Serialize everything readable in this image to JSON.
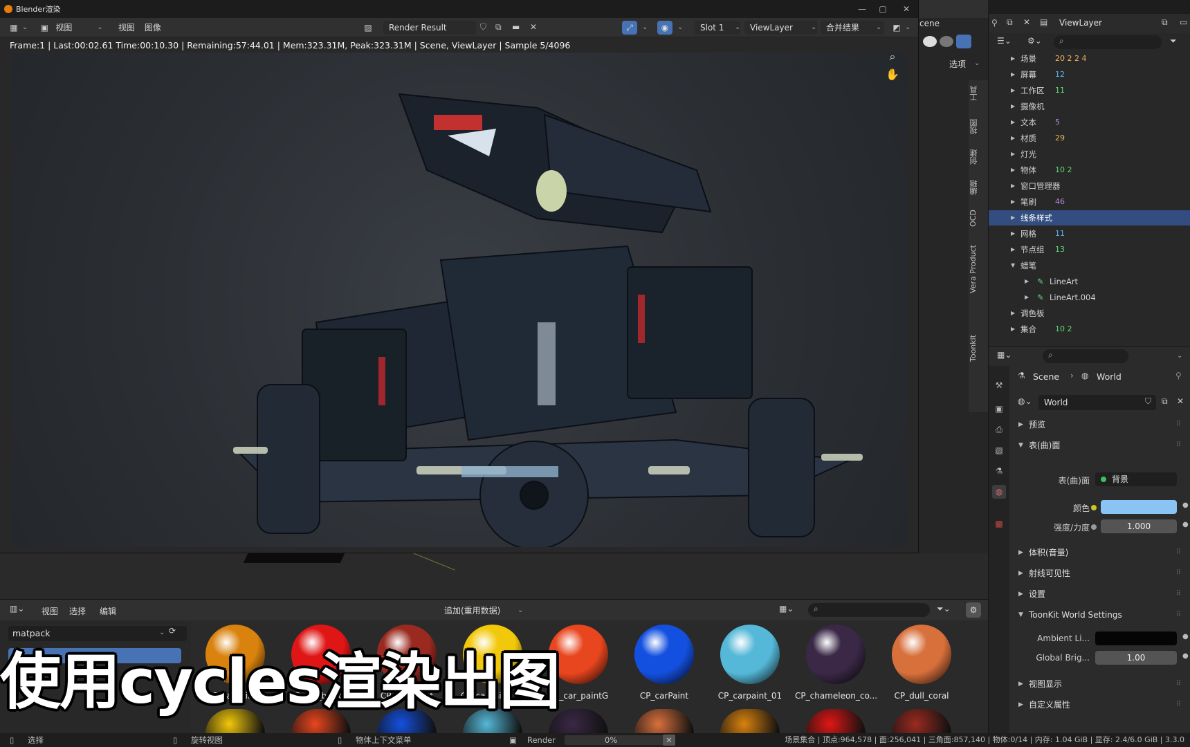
{
  "window": {
    "title": "Blender渲染",
    "controls": [
      "—",
      "▢",
      "✕"
    ]
  },
  "image_header": {
    "menus": [
      "视图",
      "视图",
      "图像"
    ],
    "image_name": "Render Result",
    "slot": "Slot 1",
    "view_layer": "ViewLayer",
    "pass": "合并结果"
  },
  "render_stats": "Frame:1 | Last:00:02.61 Time:00:10.30 | Remaining:57:44.01 | Mem:323.31M, Peak:323.31M | Scene, ViewLayer | Sample 5/4096",
  "sidebar_tabs": [
    "工具",
    "视图",
    "创建",
    "编辑",
    "OCD",
    "Vera Product",
    "Toonkit"
  ],
  "sidebar_options_label": "选项",
  "outliner": {
    "scene_fragment": "cene",
    "view_layer": "ViewLayer",
    "rows": [
      {
        "label": "场景",
        "icons": "20  2  2  4",
        "selected": false
      },
      {
        "label": "屏幕",
        "icons": "12",
        "selected": false
      },
      {
        "label": "工作区",
        "icons": "11",
        "selected": false
      },
      {
        "label": "摄像机",
        "icons": "",
        "selected": false
      },
      {
        "label": "文本",
        "icons": "5",
        "selected": false
      },
      {
        "label": "材质",
        "icons": "29",
        "selected": false
      },
      {
        "label": "灯光",
        "icons": "",
        "selected": false
      },
      {
        "label": "物体",
        "icons": "10  2",
        "selected": false
      },
      {
        "label": "窗口管理器",
        "icons": "",
        "selected": false
      },
      {
        "label": "笔刷",
        "icons": "46",
        "selected": false
      },
      {
        "label": "线条样式",
        "icons": "",
        "selected": true
      },
      {
        "label": "网格",
        "icons": "11",
        "selected": false
      },
      {
        "label": "节点组",
        "icons": "13",
        "selected": false
      },
      {
        "label": "蜡笔",
        "icons": "",
        "selected": false,
        "expanded": true
      },
      {
        "label": "LineArt",
        "icons": "",
        "child": true
      },
      {
        "label": "LineArt.004",
        "icons": "",
        "child": true
      },
      {
        "label": "调色板",
        "icons": "",
        "selected": false
      },
      {
        "label": "集合",
        "icons": "10  2",
        "selected": false
      }
    ]
  },
  "properties": {
    "breadcrumb_scene": "Scene",
    "breadcrumb_world": "World",
    "world_name": "World",
    "sections": {
      "preview": "预览",
      "surface": "表(曲)面",
      "volume": "体积(音量)",
      "ray_visibility": "射线可见性",
      "settings": "设置",
      "toonkit": "ToonKit World Settings",
      "viewport_display": "视图显示",
      "custom_props": "自定义属性"
    },
    "surface_label": "表(曲)面",
    "surface_value": "背景",
    "color_label": "颜色",
    "color_value": "#89c4f4",
    "strength_label": "强度/力度",
    "strength_value": "1.000",
    "ambient_label": "Ambient Li...",
    "global_label": "Global Brig...",
    "global_value": "1.00"
  },
  "asset_browser": {
    "menus": [
      "视图",
      "选择",
      "编辑"
    ],
    "import_mode": "追加(重用数据)",
    "library": "matpack",
    "materials": [
      {
        "label": "CP_carpaint_f",
        "color": "#d9820e"
      },
      {
        "label": "CP_car_basic_C",
        "color": "#e01616"
      },
      {
        "label": "CP_car_Paint",
        "color": "#9a2a20"
      },
      {
        "label": "CP_carpaint1_b",
        "color": "#f2c80a"
      },
      {
        "label": "CP_car_paintG",
        "color": "#e8461e"
      },
      {
        "label": "CP_carPaint",
        "color": "#1450e0"
      },
      {
        "label": "CP_carpaint_01",
        "color": "#55b8d8"
      },
      {
        "label": "CP_chameleon_co...",
        "color": "#3a2846"
      },
      {
        "label": "CP_dull_coral",
        "color": "#d8703c"
      }
    ]
  },
  "caption": "使用cycles渲染出图",
  "status_bar": {
    "select": "选择",
    "rotate": "旋转视图",
    "context": "物体上下文菜单",
    "render_label": "Render",
    "render_progress": "0%",
    "stats": "场景集合 | 顶点:964,578 | 面:256,041 | 三角面:857,140 | 物体:0/14 | 内存: 1.04 GiB | 显存: 2.4/6.0 GiB | 3.3.0"
  }
}
